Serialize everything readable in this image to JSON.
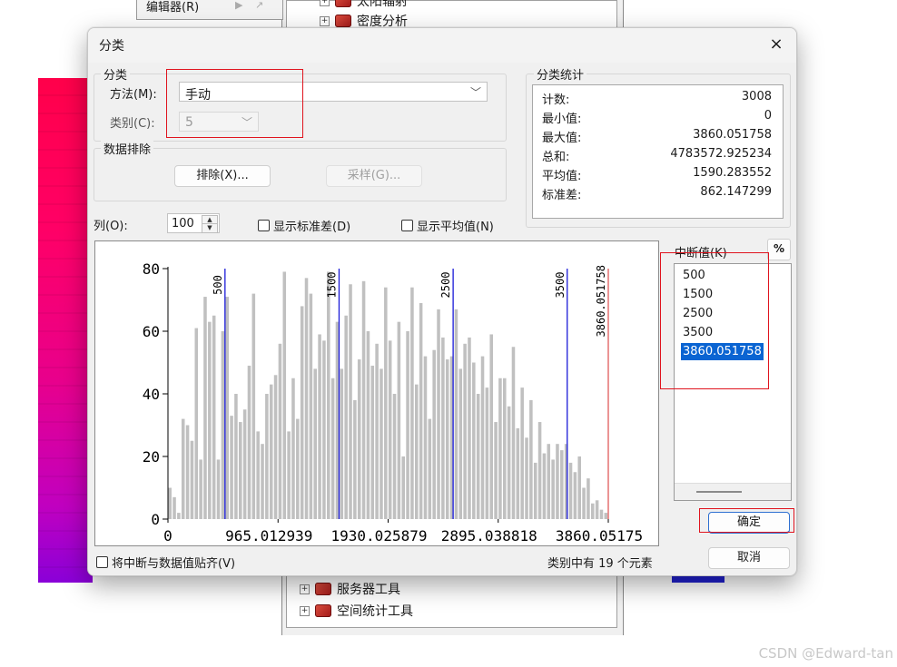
{
  "background": {
    "toolbar": {
      "editor_menu": "编辑器(R)"
    },
    "tree_top": [
      "太阳辐射",
      "密度分析"
    ],
    "tree_bottom": [
      "服务器工具",
      "空间统计工具"
    ],
    "watermark": "CSDN @Edward-tan"
  },
  "dialog": {
    "title": "分类",
    "close": "×",
    "classification": {
      "group_label": "分类",
      "method_label": "方法(M):",
      "method_value": "手动",
      "classes_label": "类别(C):",
      "classes_value": "5"
    },
    "exclusion": {
      "group_label": "数据排除",
      "exclude_button": "排除(X)...",
      "sampling_button": "采样(G)..."
    },
    "stats": {
      "group_label": "分类统计",
      "rows": [
        {
          "key": "计数:",
          "value": "3008"
        },
        {
          "key": "最小值:",
          "value": "0"
        },
        {
          "key": "最大值:",
          "value": "3860.051758"
        },
        {
          "key": "总和:",
          "value": "4783572.925234"
        },
        {
          "key": "平均值:",
          "value": "1590.283552"
        },
        {
          "key": "标准差:",
          "value": "862.147299"
        }
      ]
    },
    "columns_label": "列(O):",
    "columns_value": "100",
    "show_std": "显示标准差(D)",
    "show_mean": "显示平均值(N)",
    "breaks_label": "中断值(K)",
    "pct_button": "%",
    "breaks": [
      "500",
      "1500",
      "2500",
      "3500",
      "3860.051758"
    ],
    "selected_break_index": 4,
    "snap_label": "将中断与数据值贴齐(V)",
    "status_text": "类别中有 19 个元素",
    "ok_button": "确定",
    "cancel_button": "取消"
  },
  "chart_data": {
    "type": "bar",
    "title": "",
    "xlabel": "",
    "ylabel": "",
    "ylim": [
      0,
      80
    ],
    "xlim": [
      0,
      3860.051758
    ],
    "y_ticks": [
      0,
      20,
      40,
      60,
      80
    ],
    "x_tick_labels": [
      "0",
      "965.012939",
      "1930.025879",
      "2895.038818",
      "3860.05175"
    ],
    "x_tick_values": [
      0,
      965.012939,
      1930.025879,
      2895.038818,
      3860.051758
    ],
    "break_lines": [
      {
        "value": 500,
        "label": "500",
        "color": "#1a1ad8"
      },
      {
        "value": 1500,
        "label": "1500",
        "color": "#1a1ad8"
      },
      {
        "value": 2500,
        "label": "2500",
        "color": "#1a1ad8"
      },
      {
        "value": 3500,
        "label": "3500",
        "color": "#1a1ad8"
      },
      {
        "value": 3860.051758,
        "label": "3860.051758",
        "color": "#e05a5a"
      }
    ],
    "bar_color": "#c0c0c0",
    "bins": 100,
    "values": [
      10,
      7,
      2,
      32,
      30,
      25,
      61,
      19,
      71,
      63,
      65,
      19,
      60,
      71,
      33,
      40,
      31,
      35,
      49,
      72,
      28,
      24,
      40,
      43,
      46,
      56,
      79,
      28,
      45,
      32,
      68,
      77,
      72,
      48,
      59,
      57,
      79,
      45,
      63,
      48,
      65,
      75,
      38,
      51,
      76,
      60,
      49,
      56,
      48,
      74,
      57,
      40,
      63,
      20,
      60,
      74,
      43,
      69,
      52,
      32,
      54,
      67,
      58,
      51,
      52,
      67,
      48,
      56,
      58,
      50,
      40,
      52,
      42,
      59,
      31,
      45,
      45,
      36,
      55,
      29,
      42,
      26,
      38,
      18,
      31,
      21,
      24,
      19,
      24,
      22,
      24,
      18,
      15,
      20,
      10,
      13,
      5,
      6,
      3,
      2
    ]
  }
}
